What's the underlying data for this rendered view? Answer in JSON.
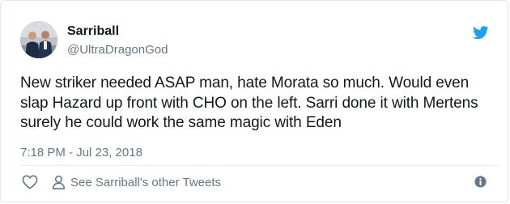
{
  "tweet": {
    "display_name": "Sarriball",
    "handle": "@UltraDragonGod",
    "text": "New striker needed ASAP man, hate Morata so much. Would even slap Hazard up front with CHO on the left. Sarri done it with Mertens surely he could work the same magic with Eden",
    "timestamp": "7:18 PM - Jul 23, 2018"
  },
  "actions": {
    "see_more": "See Sarriball's other Tweets"
  },
  "icons": {
    "brand": "twitter-bird-icon",
    "like": "heart-icon",
    "profile": "person-icon",
    "info": "info-icon"
  },
  "colors": {
    "twitter_blue": "#1da1f2",
    "secondary_text": "#657786",
    "primary_text": "#14171a"
  }
}
